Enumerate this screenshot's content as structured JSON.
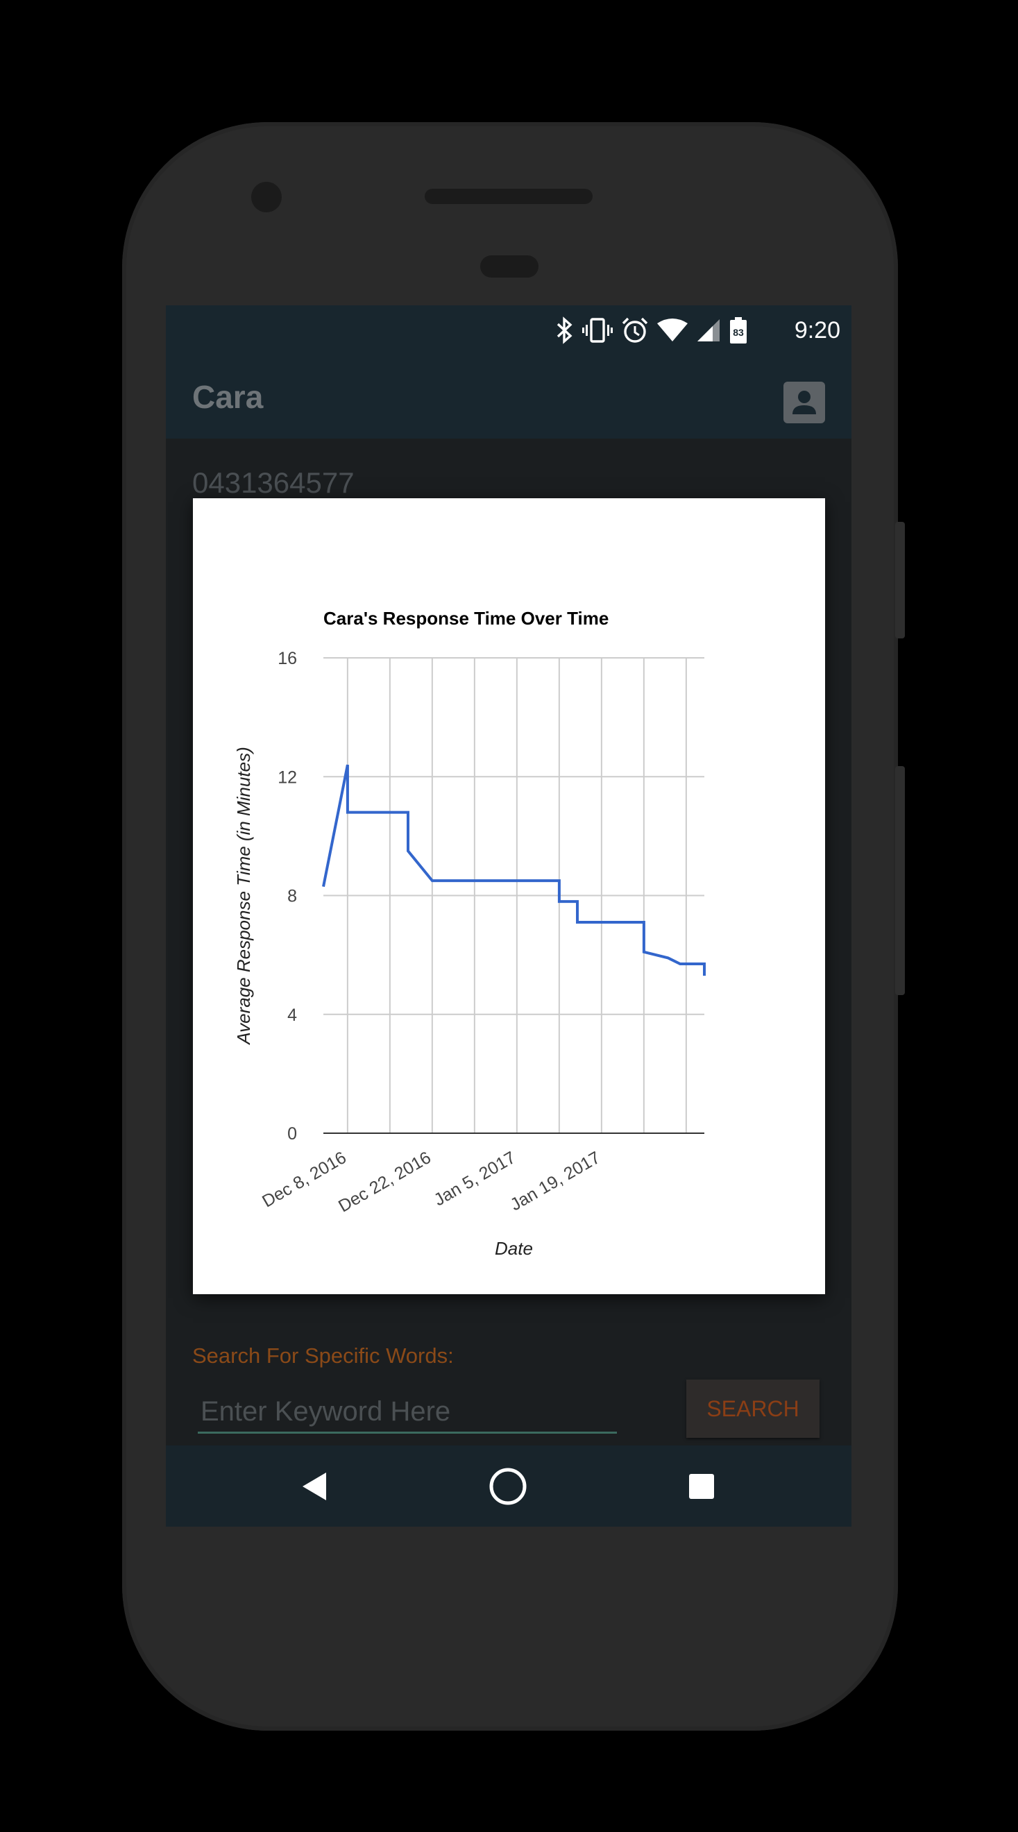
{
  "status_bar": {
    "time": "9:20",
    "battery_level": "83",
    "icons": [
      "bluetooth-icon",
      "vibrate-icon",
      "alarm-icon",
      "wifi-icon",
      "signal-icon",
      "battery-icon"
    ]
  },
  "app_bar": {
    "title": "Cara",
    "profile_icon": "account-box-icon"
  },
  "contact": {
    "phone_number": "0431364577"
  },
  "search": {
    "label": "Search For Specific Words:",
    "placeholder": "Enter Keyword Here",
    "value": "",
    "button_label": "SEARCH"
  },
  "nav_bar": {
    "back": "back-triangle-icon",
    "home": "home-circle-icon",
    "recents": "recents-square-icon"
  },
  "colors": {
    "series": "#3366cc",
    "accent": "#8b4a18",
    "appbar": "#18262e"
  },
  "chart_data": {
    "type": "line",
    "title": "Cara's Response Time Over Time",
    "xlabel": "Date",
    "ylabel": "Average Response Time (in Minutes)",
    "ylim": [
      0,
      16
    ],
    "yticks": [
      0,
      4,
      8,
      12,
      16
    ],
    "xlim": [
      "2016-12-04",
      "2017-02-05"
    ],
    "xticks": [
      {
        "date": "2016-12-08",
        "label": "Dec 8, 2016"
      },
      {
        "date": "2016-12-22",
        "label": "Dec 22, 2016"
      },
      {
        "date": "2017-01-05",
        "label": "Jan 5, 2017"
      },
      {
        "date": "2017-01-19",
        "label": "Jan 19, 2017"
      }
    ],
    "grid": true,
    "legend": "none",
    "series": [
      {
        "values": [
          {
            "x": "2016-12-04",
            "y": 8.3
          },
          {
            "x": "2016-12-08",
            "y": 12.4
          },
          {
            "x": "2016-12-08",
            "y": 10.8
          },
          {
            "x": "2016-12-18",
            "y": 10.8
          },
          {
            "x": "2016-12-18",
            "y": 9.5
          },
          {
            "x": "2016-12-22",
            "y": 8.5
          },
          {
            "x": "2017-01-12",
            "y": 8.5
          },
          {
            "x": "2017-01-12",
            "y": 7.8
          },
          {
            "x": "2017-01-15",
            "y": 7.8
          },
          {
            "x": "2017-01-15",
            "y": 7.1
          },
          {
            "x": "2017-01-23",
            "y": 7.1
          },
          {
            "x": "2017-01-26",
            "y": 7.1
          },
          {
            "x": "2017-01-26",
            "y": 6.1
          },
          {
            "x": "2017-01-30",
            "y": 5.9
          },
          {
            "x": "2017-02-01",
            "y": 5.7
          },
          {
            "x": "2017-02-05",
            "y": 5.7
          },
          {
            "x": "2017-02-05",
            "y": 5.3
          }
        ]
      }
    ]
  }
}
